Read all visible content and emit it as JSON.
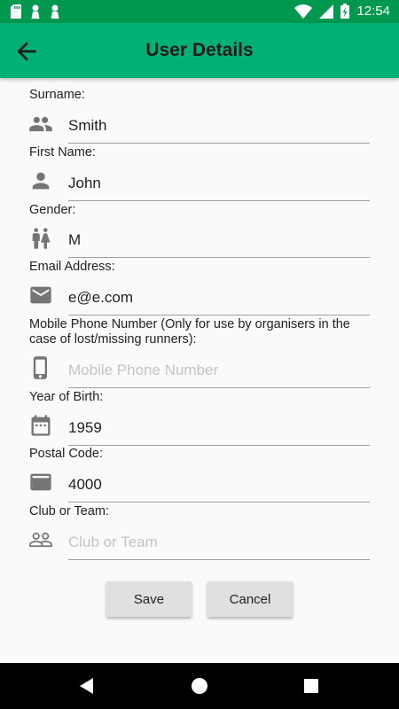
{
  "status_bar": {
    "time": "12:54",
    "left_icons": [
      "sd-card-icon",
      "pawn-icon",
      "pawn-icon"
    ],
    "right_icons": [
      "wifi-icon",
      "signal-icon",
      "battery-charging-icon"
    ]
  },
  "app_bar": {
    "title": "User Details",
    "back_icon": "arrow-left-icon",
    "background": "#00b074"
  },
  "form": {
    "fields": [
      {
        "label": "Surname:",
        "value": "Smith",
        "placeholder": "",
        "icon": "people-icon"
      },
      {
        "label": "First Name:",
        "value": "John",
        "placeholder": "",
        "icon": "person-icon"
      },
      {
        "label": "Gender:",
        "value": "M",
        "placeholder": "",
        "icon": "gender-icon"
      },
      {
        "label": "Email Address:",
        "value": "e@e.com",
        "placeholder": "",
        "icon": "email-icon"
      },
      {
        "label": "Mobile Phone Number (Only for use by organisers in the case of lost/missing runners):",
        "value": "",
        "placeholder": "Mobile Phone Number",
        "icon": "phone-icon"
      },
      {
        "label": "Year of Birth:",
        "value": "1959",
        "placeholder": "",
        "icon": "calendar-icon"
      },
      {
        "label": "Postal Code:",
        "value": "4000",
        "placeholder": "",
        "icon": "postal-card-icon"
      },
      {
        "label": "Club or Team:",
        "value": "",
        "placeholder": "Club or Team",
        "icon": "group-outline-icon"
      }
    ]
  },
  "buttons": {
    "save_label": "Save",
    "cancel_label": "Cancel"
  },
  "nav_bar": {
    "icons": [
      "nav-back-icon",
      "nav-home-icon",
      "nav-recents-icon"
    ]
  }
}
